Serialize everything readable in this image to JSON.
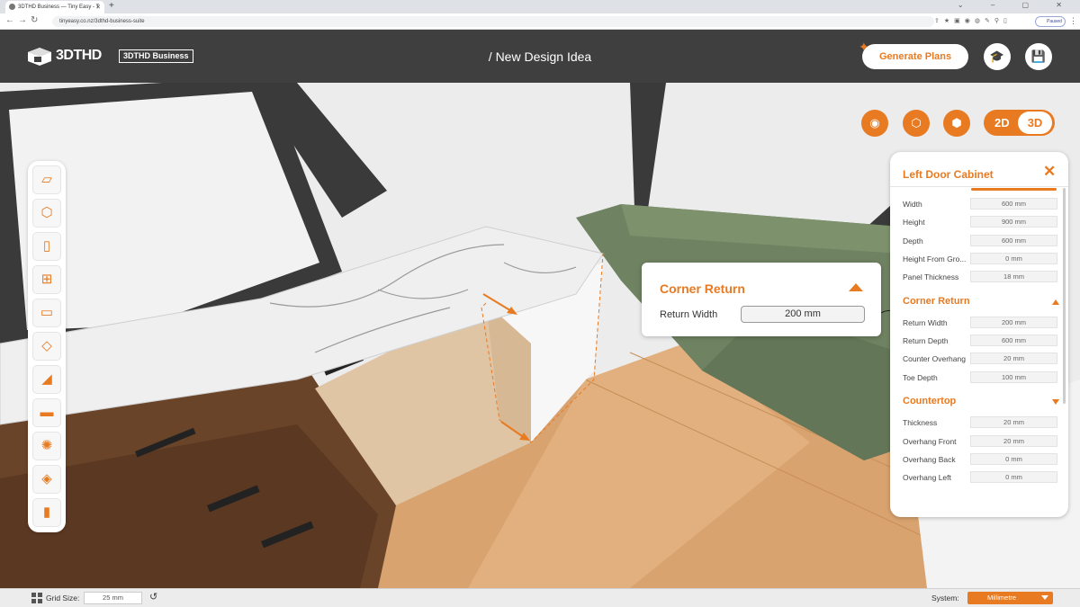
{
  "browser": {
    "tab_title": "3DTHD Business — Tiny Easy - T",
    "url": "tinyeasy.co.nz/3dthd-business-suite",
    "profile_label": "Paused"
  },
  "header": {
    "logo_text": "3DTHD",
    "badge": "3DTHD Business",
    "design_title": "/ New Design Idea",
    "generate_label": "Generate Plans",
    "learn_icon": "graduation-cap-icon",
    "save_icon": "floppy-disk-icon"
  },
  "view_controls": {
    "toggle_2d": "2D",
    "toggle_3d": "3D",
    "active_view": "3D",
    "icons": [
      "tape-measure-icon",
      "camera-box-icon",
      "camera-cube-icon"
    ]
  },
  "toolbar": {
    "tools": [
      "floor-icon",
      "room-cube-icon",
      "door-icon",
      "window-icon",
      "wall-panel-icon",
      "slab-icon",
      "stairs-icon",
      "sofa-icon",
      "light-bulb-icon",
      "paint-bucket-icon",
      "bookmark-icon"
    ]
  },
  "popup": {
    "title": "Corner Return",
    "field_label": "Return Width",
    "field_value": "200 mm"
  },
  "panel": {
    "title": "Left Door Cabinet",
    "main_rows": [
      {
        "label": "Width",
        "value": "600 mm"
      },
      {
        "label": "Height",
        "value": "900 mm"
      },
      {
        "label": "Depth",
        "value": "600 mm"
      },
      {
        "label": "Height From Gro...",
        "value": "0 mm"
      },
      {
        "label": "Panel Thickness",
        "value": "18 mm"
      }
    ],
    "corner_title": "Corner Return",
    "corner_rows": [
      {
        "label": "Return Width",
        "value": "200 mm"
      },
      {
        "label": "Return Depth",
        "value": "600 mm"
      },
      {
        "label": "Counter Overhang",
        "value": "20 mm"
      },
      {
        "label": "Toe Depth",
        "value": "100 mm"
      }
    ],
    "countertop_title": "Countertop",
    "countertop_rows": [
      {
        "label": "Thickness",
        "value": "20 mm"
      },
      {
        "label": "Overhang Front",
        "value": "20 mm"
      },
      {
        "label": "Overhang Back",
        "value": "0 mm"
      },
      {
        "label": "Overhang Left",
        "value": "0 mm"
      }
    ]
  },
  "bottom": {
    "grid_label": "Grid Size:",
    "grid_value": "25 mm",
    "system_label": "System:",
    "system_value": "Millimetre"
  },
  "colors": {
    "accent": "#e87a21",
    "header_bg": "#3f3f3f"
  }
}
